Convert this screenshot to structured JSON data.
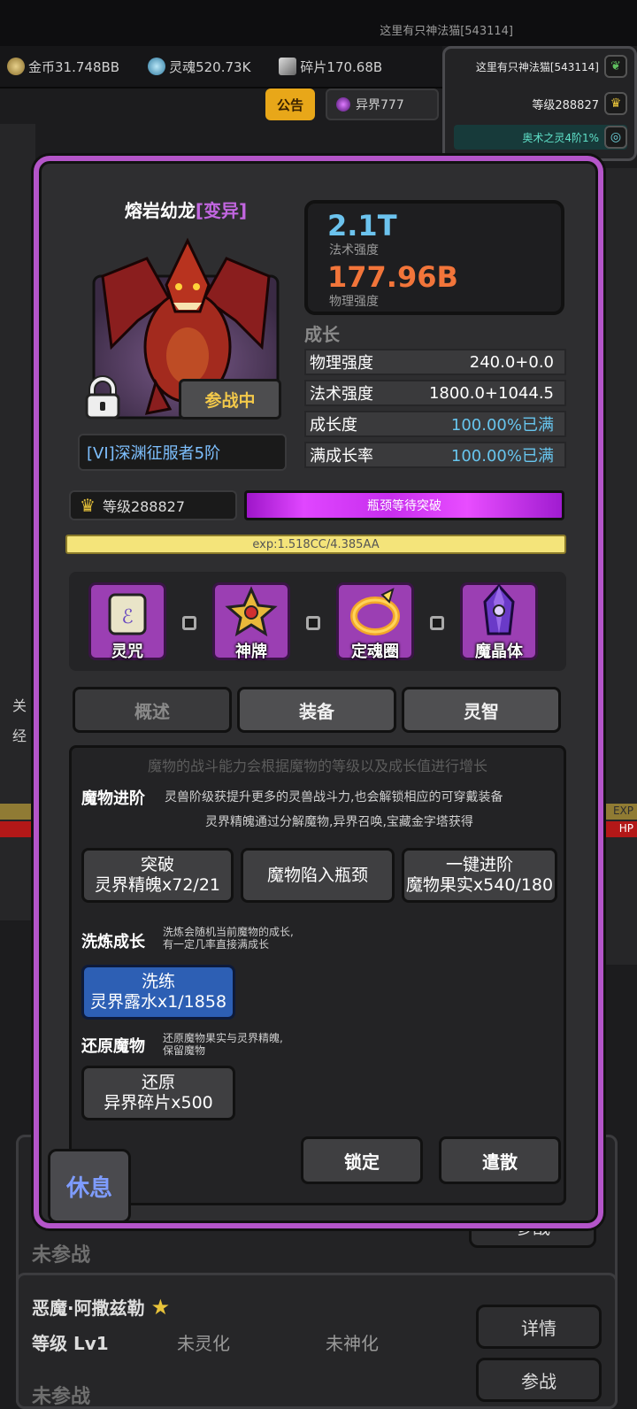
{
  "status_bar": {
    "title": "这里有只神法猫[543114]"
  },
  "resources": [
    {
      "label": "金币31.748BB",
      "color": "#c0a560",
      "icon": "coin-icon"
    },
    {
      "label": "灵魂520.73K",
      "color": "#6fb6d8",
      "icon": "soul-icon"
    },
    {
      "label": "碎片170.68B",
      "color": "#a0a0a0",
      "icon": "shard-icon"
    }
  ],
  "player": {
    "name": "这里有只神法猫[543114]",
    "level": "等级288827",
    "buff": "奥术之灵4阶1%"
  },
  "notice_label": "公告",
  "realm_label": "异界777",
  "monster": {
    "name": "熔岩幼龙",
    "mutation": "[变异]",
    "status": "参战中",
    "rank": "[VI]深渊征服者5阶",
    "magic_power": "2.1T",
    "magic_power_label": "法术强度",
    "phys_power": "177.96B",
    "phys_power_label": "物理强度",
    "growth_title": "成长",
    "stats": [
      {
        "label": "物理强度",
        "value": "240.0+0.0",
        "full": false
      },
      {
        "label": "法术强度",
        "value": "1800.0+1044.5",
        "full": false
      },
      {
        "label": "成长度",
        "value": "100.00%已满",
        "full": true
      },
      {
        "label": "满成长率",
        "value": "100.00%已满",
        "full": true
      }
    ],
    "level": "等级288827",
    "break_status": "瓶颈等待突破",
    "exp": "exp:1.518CC/4.385AA"
  },
  "equip_slots": [
    {
      "label": "灵咒",
      "icon": "scroll-icon"
    },
    {
      "label": "神牌",
      "icon": "divine-card-icon"
    },
    {
      "label": "定魂圈",
      "icon": "soul-ring-icon"
    },
    {
      "label": "魔晶体",
      "icon": "magic-crystal-icon"
    }
  ],
  "tabs": [
    {
      "label": "概述",
      "active": false
    },
    {
      "label": "装备",
      "active": true
    },
    {
      "label": "灵智",
      "active": true
    }
  ],
  "content": {
    "hint": "魔物的战斗能力会根据魔物的等级以及成长值进行增长",
    "advance": {
      "title": "魔物进阶",
      "desc1": "灵兽阶级获提升更多的灵兽战斗力,也会解锁相应的可穿戴装备",
      "desc2": "灵界精魄通过分解魔物,异界召唤,宝藏金字塔获得",
      "btn_break_l1": "突破",
      "btn_break_l2": "灵界精魄x72/21",
      "btn_bottleneck": "魔物陷入瓶颈",
      "btn_oneclick_l1": "一键进阶",
      "btn_oneclick_l2": "魔物果实x540/180"
    },
    "refine": {
      "title": "洗炼成长",
      "desc1": "洗炼会随机当前魔物的成长,",
      "desc2": "有一定几率直接满成长",
      "btn_l1": "洗练",
      "btn_l2": "灵界露水x1/1858"
    },
    "restore": {
      "title": "还原魔物",
      "desc1": "还原魔物果实与灵界精魄,",
      "desc2": "保留魔物",
      "btn_l1": "还原",
      "btn_l2": "异界碎片x500"
    },
    "lock_label": "锁定",
    "dismiss_label": "遣散"
  },
  "rest_label": "休息",
  "background": {
    "not_in_battle_1": "未参战",
    "join_1": "参战",
    "demon_name": "恶魔·阿撒兹勒",
    "demon_level": "等级 Lv1",
    "demon_spirit": "未灵化",
    "demon_divine": "未神化",
    "detail_label": "详情",
    "join_2": "参战",
    "not_in_battle_2": "未参战",
    "side_guan": "关",
    "side_jing": "经",
    "exp_tag": "EXP",
    "hp_tag": "HP"
  }
}
